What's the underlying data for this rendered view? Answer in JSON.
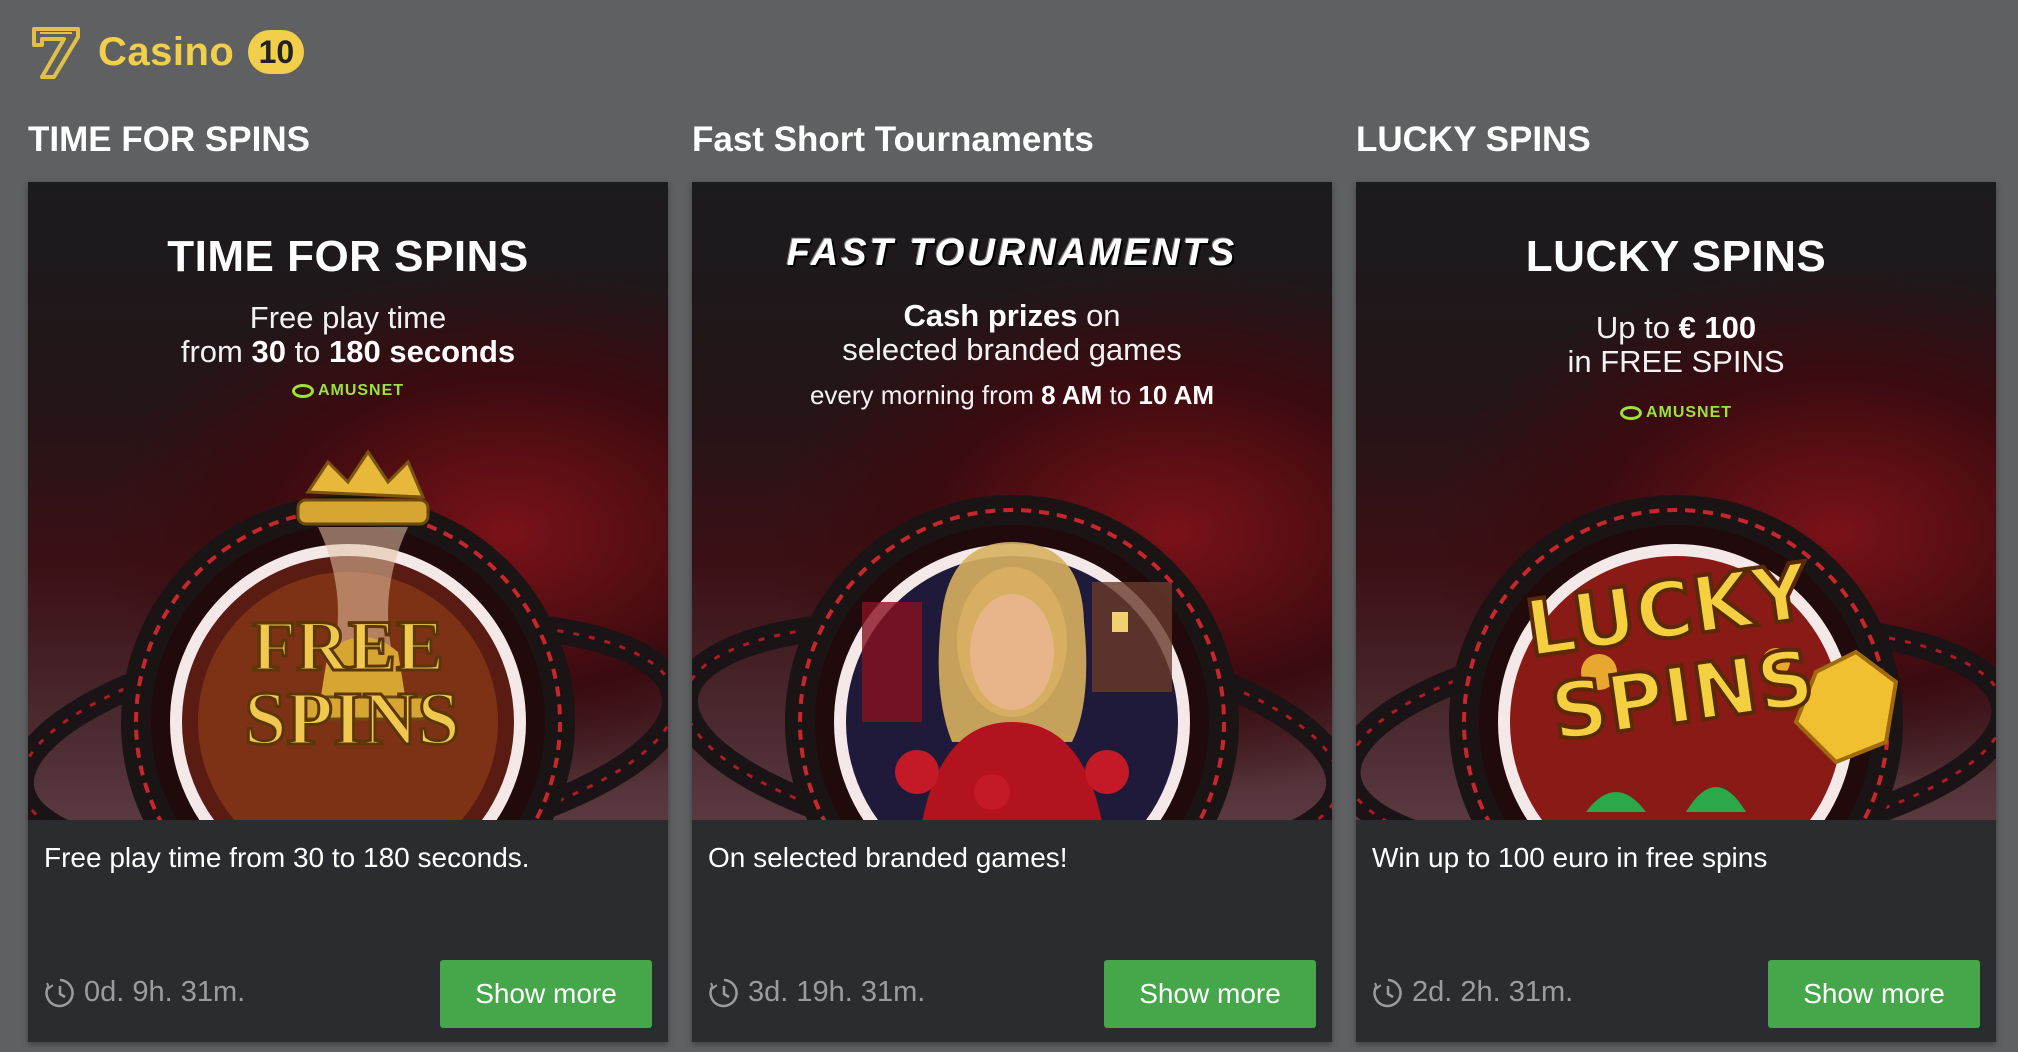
{
  "header": {
    "title": "Casino",
    "count": "10"
  },
  "colors": {
    "accent": "#f2cf4a",
    "button": "#45a74a",
    "card_bg": "#2b2c30",
    "page_bg": "#5f6062"
  },
  "promotions": [
    {
      "section_title": "TIME FOR SPINS",
      "banner": {
        "headline": "TIME FOR SPINS",
        "line1": "Free play time",
        "line2_pre": "from ",
        "line2_a": "30",
        "line2_mid": " to ",
        "line2_b": "180 seconds",
        "brand": "AMUSNET",
        "art_text_1": "FREE",
        "art_text_2": "SPINS"
      },
      "description": "Free play time from 30 to 180 seconds.",
      "timer": "0d. 9h. 31m.",
      "button_label": "Show more"
    },
    {
      "section_title": "Fast Short Tournaments",
      "banner": {
        "headline": "FAST TOURNAMENTS",
        "line1_bold": "Cash prizes",
        "line1_rest": " on",
        "line2": "selected branded games",
        "line3_pre": "every morning from ",
        "line3_a": "8 AM",
        "line3_mid": " to ",
        "line3_b": "10 AM"
      },
      "description": "On selected branded games!",
      "timer": "3d. 19h. 31m.",
      "button_label": "Show more"
    },
    {
      "section_title": "LUCKY SPINS",
      "banner": {
        "headline": "LUCKY SPINS",
        "line1_pre": "Up to ",
        "line1_bold": "€ 100",
        "line2": "in FREE SPINS",
        "brand": "AMUSNET",
        "art_text_1": "LUCKY",
        "art_text_2": "SPINS"
      },
      "description": "Win up to 100 euro in free spins",
      "timer": "2d. 2h. 31m.",
      "button_label": "Show more"
    }
  ]
}
